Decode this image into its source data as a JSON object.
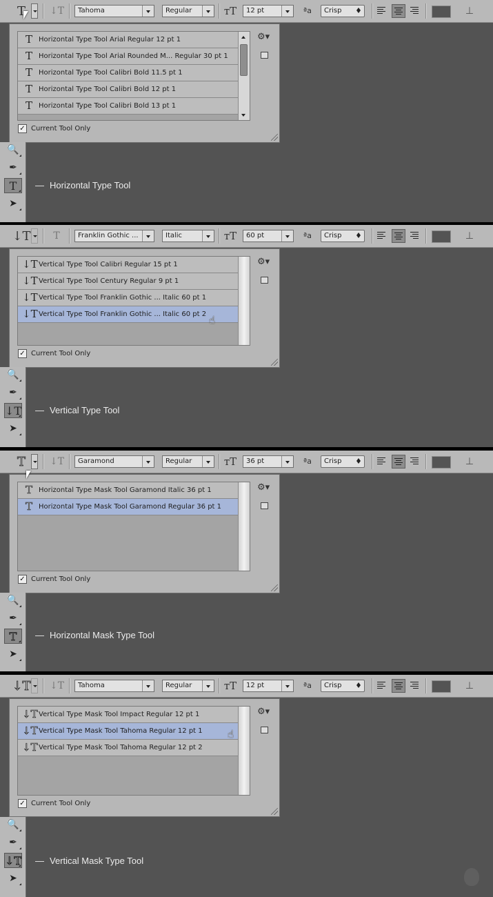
{
  "panels": [
    {
      "tool_icon": "T",
      "font": "Tahoma",
      "style": "Regular",
      "size": "12 pt",
      "antialias": "Crisp",
      "rows": [
        {
          "label": "Horizontal Type Tool Arial Regular 12 pt 1",
          "icon": "T",
          "selected": false
        },
        {
          "label": "Horizontal Type Tool Arial Rounded M... Regular 30 pt 1",
          "icon": "T",
          "selected": false
        },
        {
          "label": "Horizontal Type Tool Calibri Bold 11.5 pt 1",
          "icon": "T",
          "selected": false
        },
        {
          "label": "Horizontal Type Tool Calibri Bold 12 pt 1",
          "icon": "T",
          "selected": false
        },
        {
          "label": "Horizontal Type Tool Calibri Bold 13 pt 1",
          "icon": "T",
          "selected": false
        }
      ],
      "current_tool_only": "Current Tool Only",
      "caption": "Horizontal Type Tool",
      "active_tool_icon": "T"
    },
    {
      "tool_icon": "↓T",
      "font": "Franklin Gothic ...",
      "style": "Italic",
      "size": "60 pt",
      "antialias": "Crisp",
      "rows": [
        {
          "label": "Vertical Type Tool Calibri Regular 15 pt 1",
          "icon": "↓T",
          "selected": false
        },
        {
          "label": "Vertical Type Tool Century Regular 9 pt 1",
          "icon": "↓T",
          "selected": false
        },
        {
          "label": "Vertical Type Tool Franklin Gothic ... Italic 60 pt 1",
          "icon": "↓T",
          "selected": false
        },
        {
          "label": "Vertical Type Tool Franklin Gothic ... Italic 60 pt 2",
          "icon": "↓T",
          "selected": true
        }
      ],
      "current_tool_only": "Current Tool Only",
      "caption": "Vertical Type Tool",
      "active_tool_icon": "↓T"
    },
    {
      "tool_icon": "T",
      "font": "Garamond",
      "style": "Regular",
      "size": "36 pt",
      "antialias": "Crisp",
      "rows": [
        {
          "label": "Horizontal Type Mask Tool Garamond Italic 36 pt 1",
          "icon": "T",
          "selected": false
        },
        {
          "label": "Horizontal Type Mask Tool Garamond Regular 36 pt 1",
          "icon": "T",
          "selected": true
        }
      ],
      "current_tool_only": "Current Tool Only",
      "caption": "Horizontal Mask Type Tool",
      "active_tool_icon": "T"
    },
    {
      "tool_icon": "↓T",
      "font": "Tahoma",
      "style": "Regular",
      "size": "12 pt",
      "antialias": "Crisp",
      "rows": [
        {
          "label": "Vertical Type Mask Tool Impact Regular 12 pt 1",
          "icon": "↓T",
          "selected": false
        },
        {
          "label": "Vertical Type Mask Tool Tahoma Regular 12 pt 1",
          "icon": "↓T",
          "selected": true
        },
        {
          "label": "Vertical Type Mask Tool Tahoma Regular 12 pt 2",
          "icon": "↓T",
          "selected": false
        }
      ],
      "current_tool_only": "Current Tool Only",
      "caption": "Vertical Mask Type Tool",
      "active_tool_icon": "↓T"
    }
  ],
  "colors": {
    "workspace": "#535353",
    "options_bar": "#b9b9b9",
    "selected_row": "#a6b6d9",
    "swatch": "#545454"
  }
}
